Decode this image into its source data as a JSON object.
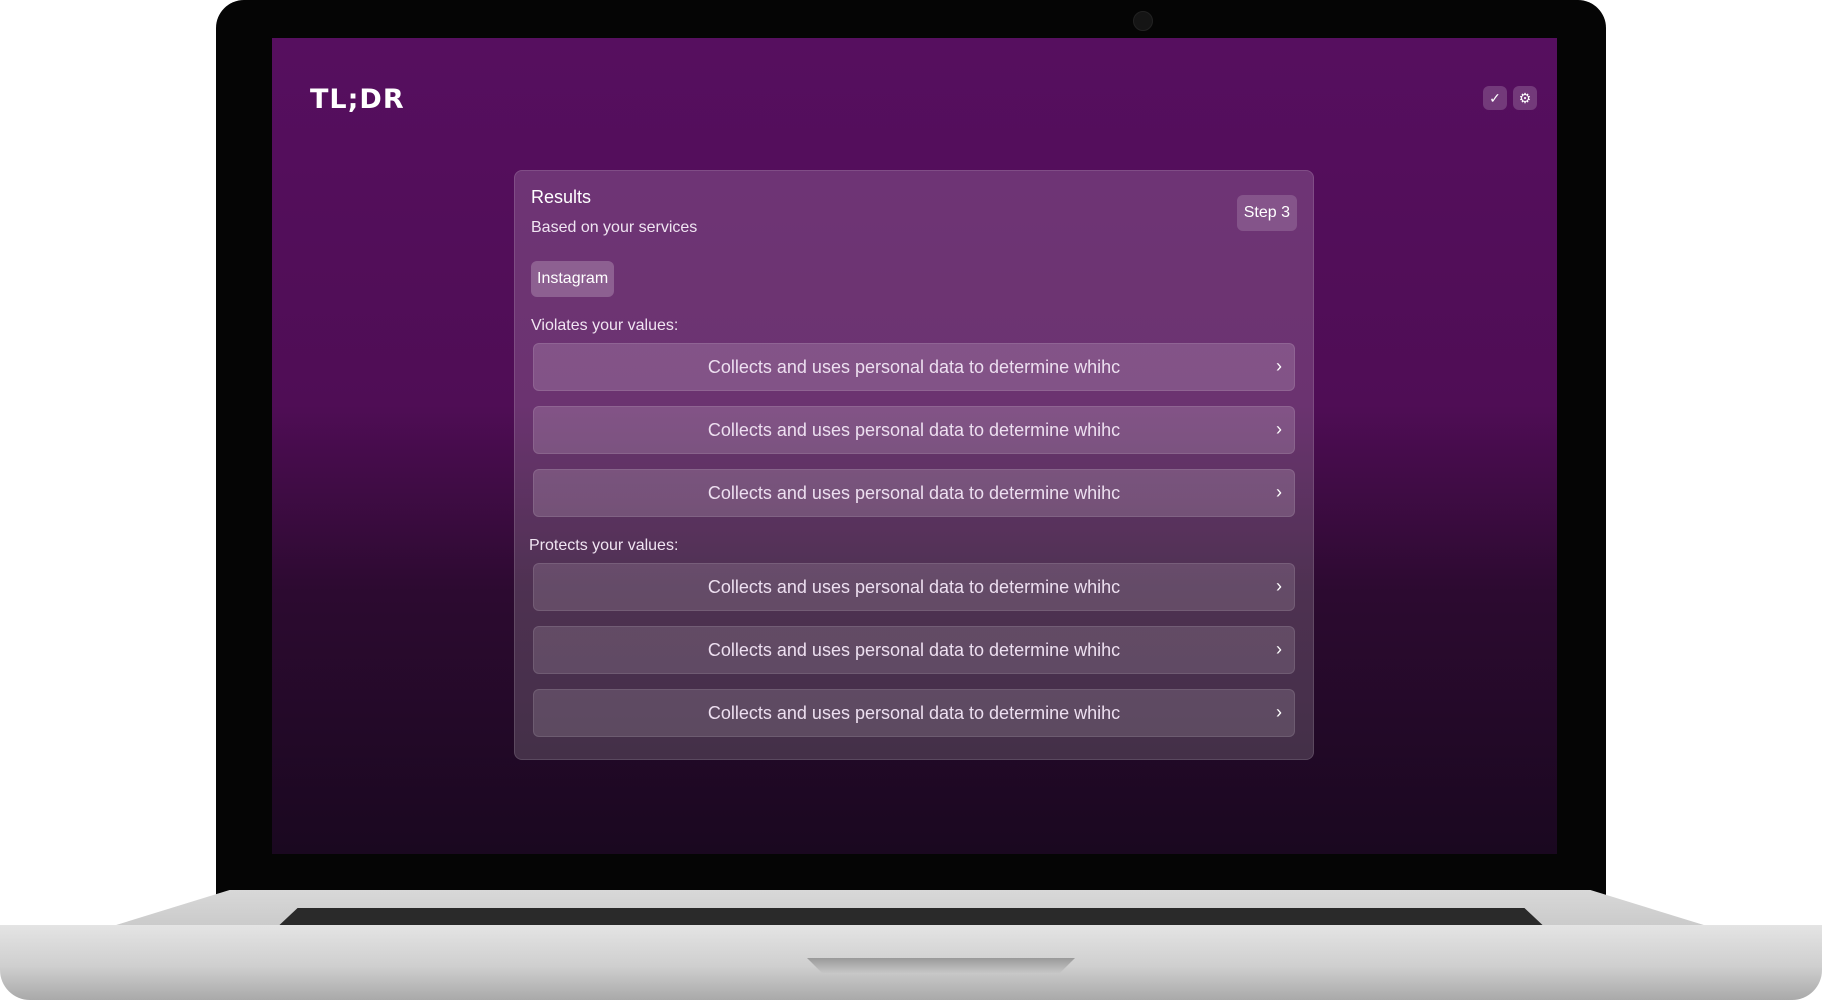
{
  "app": {
    "logo_text": "TL;DR",
    "actions": [
      {
        "icon": "check-icon",
        "glyph": "✓"
      },
      {
        "icon": "gear-icon",
        "glyph": "⚙"
      }
    ]
  },
  "colors": {
    "background_top": "#560f5f",
    "background_bottom": "#1a0820",
    "card_overlay": "rgba(255,255,255,0.16)"
  },
  "results": {
    "title": "Results",
    "subtitle": "Based on your services",
    "step_label": "Step 3",
    "service_chip": "Instagram",
    "violates_label": "Violates your values:",
    "violates_items": [
      "Collects and uses personal data to determine whihc",
      "Collects and uses personal data to determine whihc",
      "Collects and uses personal data to determine whihc"
    ],
    "protects_label": "Protects your values:",
    "protects_items": [
      "Collects and uses personal data to determine whihc",
      "Collects and uses personal data to determine whihc",
      "Collects and uses personal data to determine whihc"
    ],
    "chevron_glyph": "›"
  }
}
